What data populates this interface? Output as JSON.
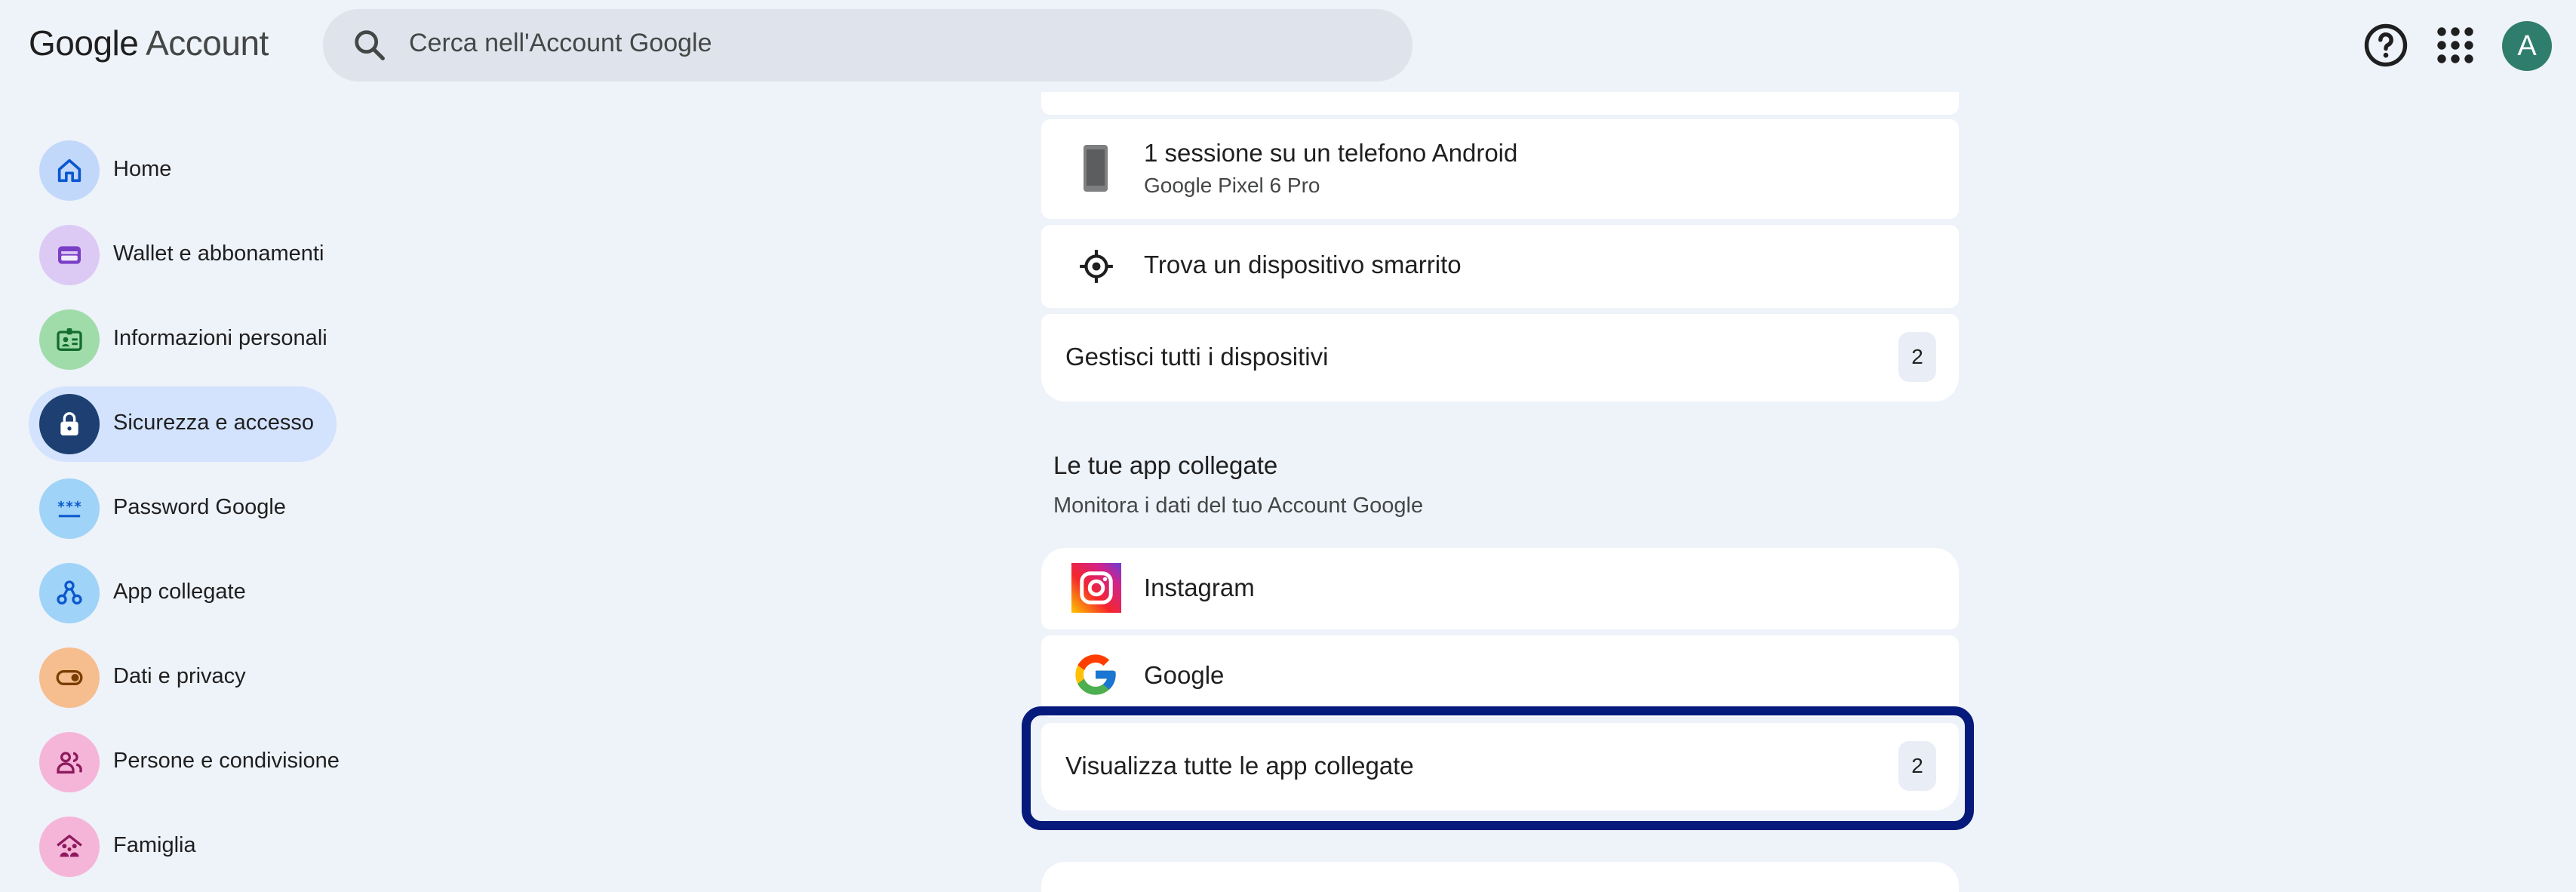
{
  "header": {
    "logo_google": "Google",
    "logo_account": "Account",
    "search_placeholder": "Cerca nell'Account Google",
    "help_icon": "help-circle-icon",
    "apps_icon": "apps-grid-icon",
    "avatar_letter": "A",
    "avatar_color": "#2f7d6d"
  },
  "sidebar": {
    "items": [
      {
        "label": "Home",
        "icon": "home-icon",
        "color": "#c2d8fb",
        "active": false
      },
      {
        "label": "Wallet e abbonamenti",
        "icon": "wallet-icon",
        "color": "#dccaf5",
        "active": false
      },
      {
        "label": "Informazioni personali",
        "icon": "id-card-icon",
        "color": "#9fdcaa",
        "active": false
      },
      {
        "label": "Sicurezza e accesso",
        "icon": "lock-icon",
        "color": "#1d3f72",
        "active": true
      },
      {
        "label": "Password Google",
        "icon": "password-icon",
        "color": "#9fd3f7",
        "active": false
      },
      {
        "label": "App collegate",
        "icon": "connected-apps-icon",
        "color": "#9fd3f7",
        "active": false
      },
      {
        "label": "Dati e privacy",
        "icon": "toggle-icon",
        "color": "#f6bd8e",
        "active": false
      },
      {
        "label": "Persone e condivisione",
        "icon": "people-icon",
        "color": "#f5b5d8",
        "active": false
      },
      {
        "label": "Famiglia",
        "icon": "family-icon",
        "color": "#f5b5d8",
        "active": false
      }
    ]
  },
  "devices": {
    "session_title": "1 sessione su un telefono Android",
    "session_device": "Google Pixel 6 Pro",
    "find_device": "Trova un dispositivo smarrito",
    "manage_all": "Gestisci tutti i dispositivi",
    "manage_count": "2"
  },
  "connected_apps": {
    "title": "Le tue app collegate",
    "subtitle": "Monitora i dati del tuo Account Google",
    "apps": [
      {
        "name": "Instagram",
        "icon": "instagram-icon"
      },
      {
        "name": "Google",
        "icon": "google-icon"
      }
    ],
    "view_all": "Visualizza tutte le app collegate",
    "view_all_count": "2"
  },
  "colors": {
    "highlight": "#051a7a",
    "active_nav": "#d3e3fd",
    "background": "#eef2f9"
  }
}
